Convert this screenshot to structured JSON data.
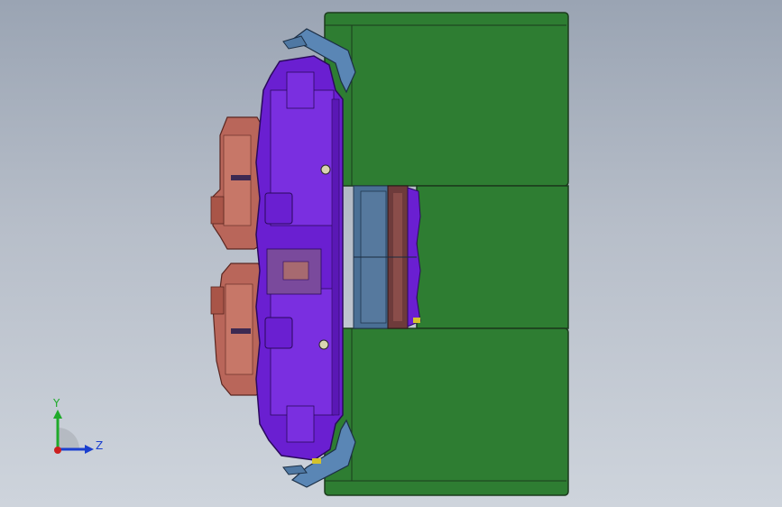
{
  "viewport": {
    "background_top": "#9aa4b3",
    "background_bottom": "#ced4dc"
  },
  "model": {
    "parts": [
      {
        "name": "green-block-top",
        "color": "#2e7d32"
      },
      {
        "name": "green-block-bottom",
        "color": "#2e7d32"
      },
      {
        "name": "green-block-middle",
        "color": "#2e7d32"
      },
      {
        "name": "purple-housing",
        "color": "#6a1fd1"
      },
      {
        "name": "salmon-motor-top",
        "color": "#b9665a"
      },
      {
        "name": "salmon-motor-bottom",
        "color": "#b9665a"
      },
      {
        "name": "steel-blue-plate",
        "color": "#4a6f95"
      },
      {
        "name": "brown-disc",
        "color": "#6e3b3b"
      },
      {
        "name": "blue-bracket-top",
        "color": "#5a86b5"
      },
      {
        "name": "blue-bracket-bottom",
        "color": "#5a86b5"
      }
    ]
  },
  "triad": {
    "y_label": "Y",
    "z_label": "Z",
    "y_color": "#1faa2a",
    "z_color": "#1a3fcf",
    "x_color": "#cc1f1f"
  }
}
